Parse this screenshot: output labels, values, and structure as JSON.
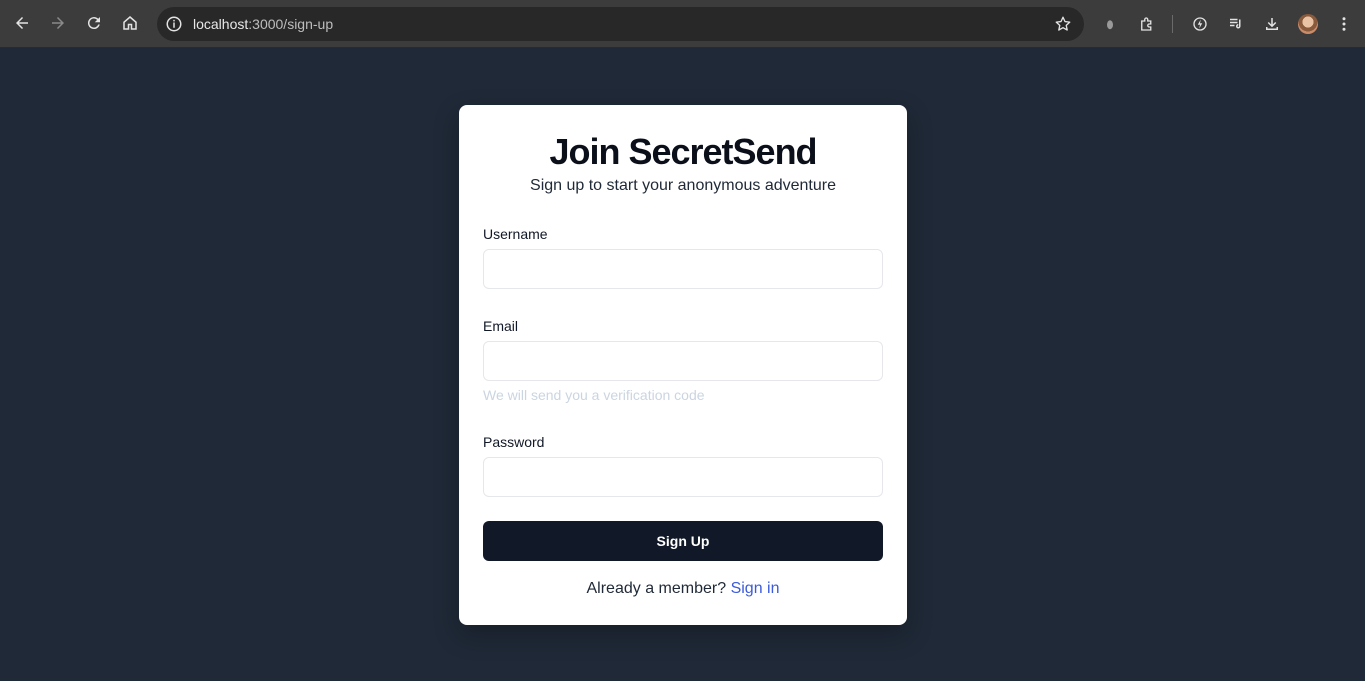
{
  "browser": {
    "url_host": "localhost",
    "url_path": ":3000/sign-up",
    "icons": [
      "back-icon",
      "forward-icon",
      "reload-icon",
      "home-icon",
      "site-info-icon",
      "bookmark-star-icon",
      "extension-puzzle-icon",
      "performance-icon",
      "media-controls-icon",
      "download-icon",
      "profile-avatar",
      "menu-icon"
    ]
  },
  "signup": {
    "title": "Join SecretSend",
    "subtitle": "Sign up to start your anonymous adventure",
    "username_label": "Username",
    "username_value": "",
    "email_label": "Email",
    "email_value": "",
    "email_hint": "We will send you a verification code",
    "password_label": "Password",
    "password_value": "",
    "submit_label": "Sign Up",
    "footer_text": "Already a member? ",
    "signin_link": "Sign in"
  },
  "colors": {
    "page_background": "#1f2937",
    "card_background": "#ffffff",
    "button_background": "#111827",
    "link": "#3b5bdb"
  }
}
